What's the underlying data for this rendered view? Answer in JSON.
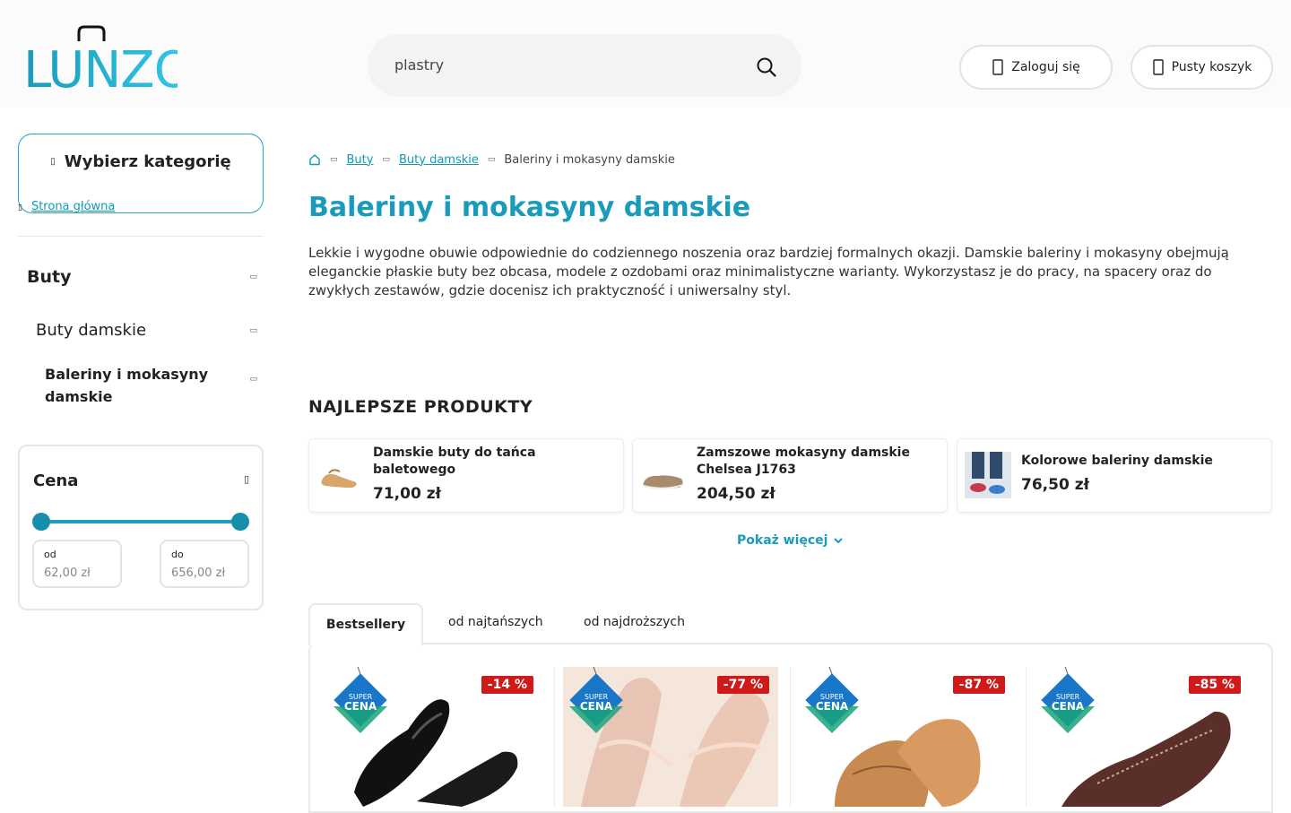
{
  "header": {
    "logo_text": "LUNZO",
    "search_value": "plastry",
    "login_label": "Zaloguj się",
    "cart_label": "Pusty koszyk",
    "colors": {
      "brand": "#1a9bbb",
      "logo_gradient_start": "#1a9bbb",
      "logo_gradient_end": "#35c8e8"
    }
  },
  "sidebar": {
    "category_button": "Wybierz kategorię",
    "home_link": "Strona główna",
    "items": [
      {
        "label": "Buty"
      },
      {
        "label": "Buty damskie"
      },
      {
        "label": "Baleriny i mokasyny damskie"
      }
    ],
    "price_filter": {
      "title": "Cena",
      "from_label": "od",
      "from_value": "62,00 zł",
      "to_label": "do",
      "to_value": "656,00 zł"
    }
  },
  "breadcrumb": {
    "items": [
      "Buty",
      "Buty damskie",
      "Baleriny i mokasyny damskie"
    ]
  },
  "main": {
    "title": "Baleriny i mokasyny damskie",
    "description": "Lekkie i wygodne obuwie odpowiednie do codziennego noszenia oraz bardziej formalnych okazji. Damskie baleriny i mokasyny obejmują eleganckie płaskie buty bez obcasa, modele z ozdobami oraz minimalistyczne warianty. Wykorzystasz je do pracy, na spacery oraz do zwykłych zestawów, gdzie docenisz ich praktyczność i uniwersalny styl.",
    "best_title": "NAJLEPSZE PRODUKTY",
    "best_products": [
      {
        "name": "Damskie buty do tańca baletowego",
        "price": "71,00 zł"
      },
      {
        "name": "Zamszowe mokasyny damskie Chelsea J1763",
        "price": "204,50 zł"
      },
      {
        "name": "Kolorowe baleriny damskie",
        "price": "76,50 zł"
      }
    ],
    "show_more": "Pokaż więcej",
    "tabs": [
      {
        "label": "Bestsellery",
        "active": true
      },
      {
        "label": "od najtańszych",
        "active": false
      },
      {
        "label": "od najdroższych",
        "active": false
      }
    ],
    "products": [
      {
        "discount": "-14 %",
        "tag": "SUPER CENA"
      },
      {
        "discount": "-77 %",
        "tag": "SUPER CENA"
      },
      {
        "discount": "-87 %",
        "tag": "SUPER CENA"
      },
      {
        "discount": "-85 %",
        "tag": "SUPER CENA"
      }
    ],
    "discount_color": "#d01919"
  }
}
